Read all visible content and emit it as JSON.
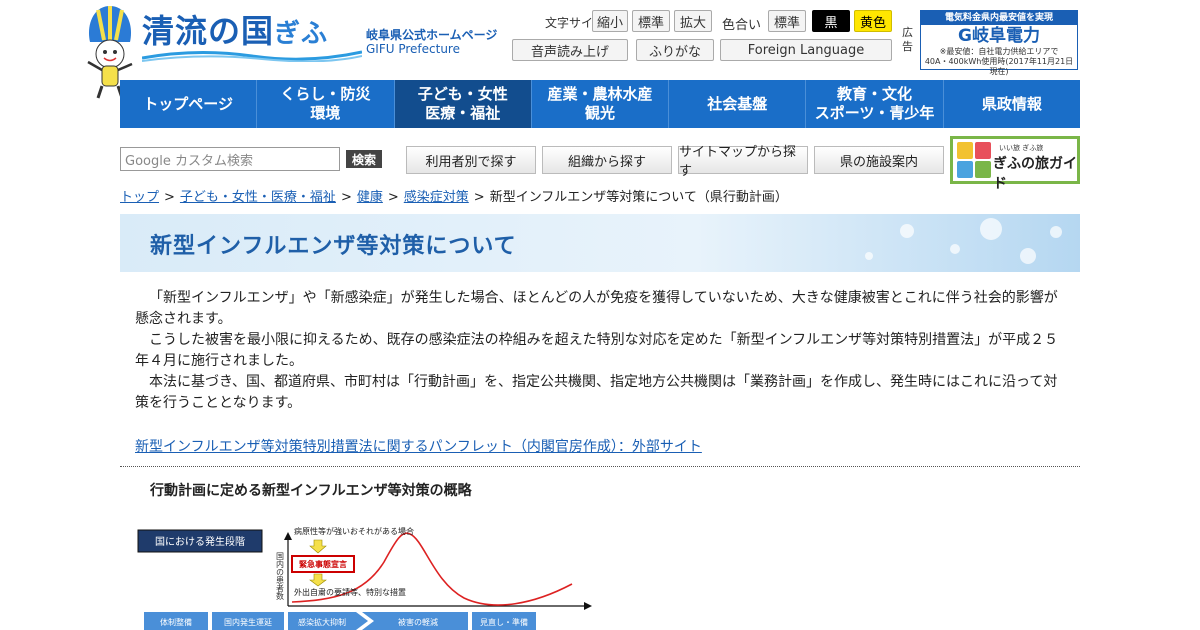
{
  "header": {
    "logo_main": "清流の国",
    "logo_suffix": "ぎふ",
    "logo_sub_ja": "岐阜県公式ホームページ",
    "logo_sub_en": "GIFU Prefecture"
  },
  "utility": {
    "font_size_label": "文字サイズ",
    "shrink": "縮小",
    "standard": "標準",
    "enlarge": "拡大",
    "color_label": "色合い",
    "color_standard": "標準",
    "color_black": "黒",
    "color_yellow": "黄色",
    "read_aloud": "音声読み上げ",
    "furigana": "ふりがな",
    "foreign_language": "Foreign Language"
  },
  "ad": {
    "label": "広告",
    "top": "電気料金県内最安値を実現",
    "brand": "G岐阜電力",
    "note1": "※最安値：自社電力供給エリアで",
    "note2": "40A・400kWh使用時(2017年11月21日現在)"
  },
  "nav": {
    "items": [
      {
        "line1": "トップページ",
        "line2": ""
      },
      {
        "line1": "くらし・防災",
        "line2": "環境"
      },
      {
        "line1": "子ども・女性",
        "line2": "医療・福祉"
      },
      {
        "line1": "産業・農林水産",
        "line2": "観光"
      },
      {
        "line1": "社会基盤",
        "line2": ""
      },
      {
        "line1": "教育・文化",
        "line2": "スポーツ・青少年"
      },
      {
        "line1": "県政情報",
        "line2": ""
      }
    ]
  },
  "search": {
    "placeholder": "Google カスタム検索",
    "button": "検索",
    "by_user": "利用者別で探す",
    "by_org": "組織から探す",
    "sitemap": "サイトマップから探す",
    "facilities": "県の施設案内",
    "guide_small": "いい旅 ぎふ旅",
    "guide": "ぎふの旅ガイド"
  },
  "breadcrumb": {
    "top": "トップ",
    "cat": "子ども・女性・医療・福祉",
    "health": "健康",
    "infection": "感染症対策",
    "current": "新型インフルエンザ等対策について（県行動計画）"
  },
  "page": {
    "title": "新型インフルエンザ等対策について",
    "para1": "「新型インフルエンザ」や「新感染症」が発生した場合、ほとんどの人が免疫を獲得していないため、大きな健康被害とこれに伴う社会的影響が懸念されます。",
    "para2": "こうした被害を最小限に抑えるため、既存の感染症法の枠組みを超えた特別な対応を定めた「新型インフルエンザ等対策特別措置法」が平成２５年４月に施行されました。",
    "para3": "本法に基づき、国、都道府県、市町村は「行動計画」を、指定公共機関、指定地方公共機関は「業務計画」を作成し、発生時にはこれに沿って対策を行うこととなります。",
    "link": "新型インフルエンザ等対策特別措置法に関するパンフレット（内閣官房作成）：外部サイト",
    "subheading": "行動計画に定める新型インフルエンザ等対策の概略"
  },
  "diagram": {
    "stage_label": "国における発生段階",
    "note_top": "病原性等が強いおそれがある場合",
    "emergency": "緊急事態宣言",
    "note_bottom": "外出自粛の要請等、特別な措置",
    "y_axis": "国内の患者数",
    "phases": [
      "体制整備",
      "国内発生運延",
      "感染拡大抑制",
      "被害の軽減",
      "見直し・準備"
    ]
  }
}
